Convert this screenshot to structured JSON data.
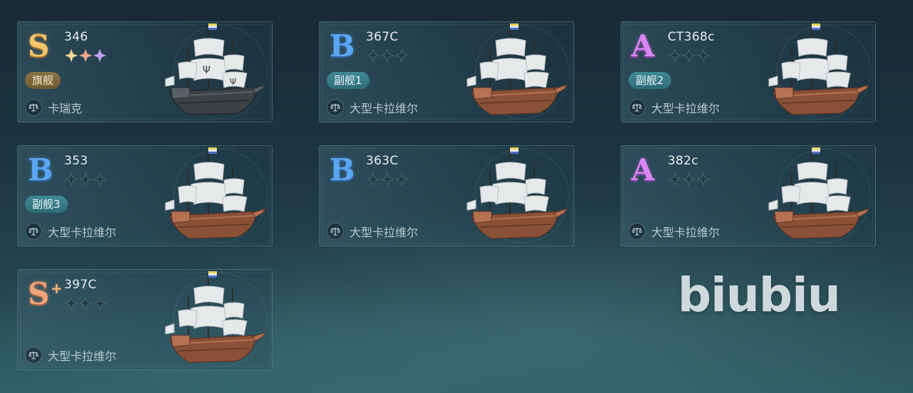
{
  "ships": [
    {
      "grade": "S",
      "grade_style": "S",
      "plus": "",
      "code": "346",
      "stars_active": [
        true,
        true,
        true
      ],
      "star_colors": [
        "#f6d89a",
        "#f0a890",
        "#c7a0f4"
      ],
      "badge": "旗舰",
      "badge_style": "gold",
      "ship_type": "卡瑞克",
      "hull": "dark"
    },
    {
      "grade": "B",
      "grade_style": "B",
      "plus": "",
      "code": "367C",
      "stars_active": [
        false,
        false,
        false
      ],
      "star_colors": [
        "",
        "",
        ""
      ],
      "badge": "副舰1",
      "badge_style": "teal",
      "ship_type": "大型卡拉维尔",
      "hull": "wood"
    },
    {
      "grade": "A",
      "grade_style": "A",
      "plus": "",
      "code": "CT368c",
      "stars_active": [
        false,
        false,
        false
      ],
      "star_colors": [
        "",
        "",
        ""
      ],
      "badge": "副舰2",
      "badge_style": "teal",
      "ship_type": "大型卡拉维尔",
      "hull": "wood"
    },
    {
      "grade": "B",
      "grade_style": "B",
      "plus": "",
      "code": "353",
      "stars_active": [
        false,
        false,
        false
      ],
      "star_colors": [
        "",
        "",
        ""
      ],
      "badge": "副舰3",
      "badge_style": "teal",
      "ship_type": "大型卡拉维尔",
      "hull": "wood"
    },
    {
      "grade": "B",
      "grade_style": "B",
      "plus": "",
      "code": "363C",
      "stars_active": [
        false,
        false,
        false
      ],
      "star_colors": [
        "",
        "",
        ""
      ],
      "badge": "",
      "badge_style": "",
      "ship_type": "大型卡拉维尔",
      "hull": "wood"
    },
    {
      "grade": "A",
      "grade_style": "A",
      "plus": "",
      "code": "382c",
      "stars_active": [
        false,
        false,
        false
      ],
      "star_colors": [
        "",
        "",
        ""
      ],
      "badge": "",
      "badge_style": "",
      "ship_type": "大型卡拉维尔",
      "hull": "wood"
    },
    {
      "grade": "S",
      "grade_style": "Sp",
      "plus": "+",
      "code": "397C",
      "stars_active": [
        false,
        false,
        false
      ],
      "star_colors": [
        "",
        "",
        ""
      ],
      "badge": "",
      "badge_style": "",
      "ship_type": "大型卡拉维尔",
      "hull": "wood"
    }
  ],
  "icons": {
    "type_icon": "balance-scale-icon",
    "star_icon": "four-point-star-icon"
  },
  "colors": {
    "inactive_star": "#1e3640",
    "inactive_star_stroke": "#4f6e78"
  },
  "watermark": "biubiu"
}
